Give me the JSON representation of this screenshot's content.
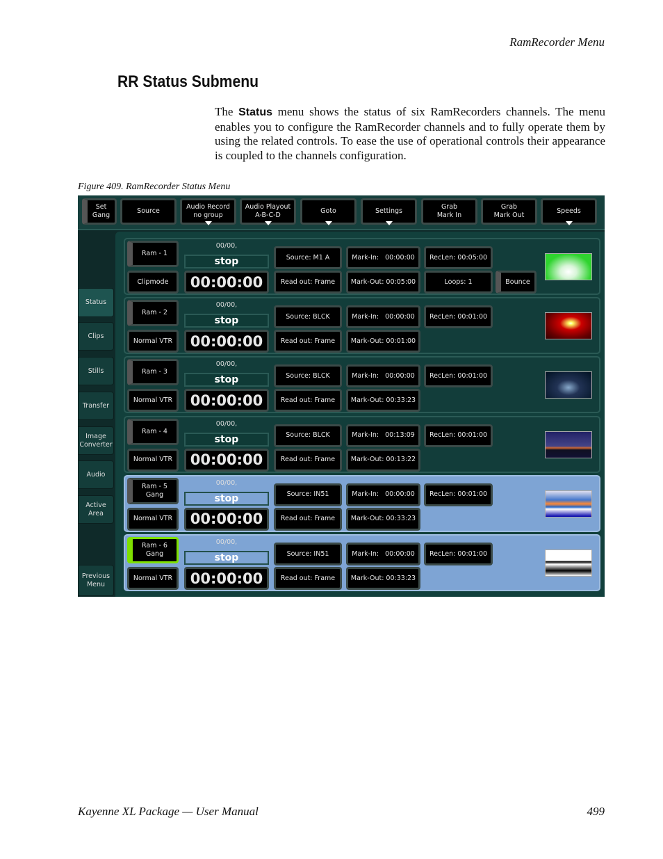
{
  "page": {
    "running_header": "RamRecorder Menu",
    "section_title": "RR Status Submenu",
    "intro_pre": "The ",
    "intro_bold": "Status",
    "intro_post": " menu shows the status of six RamRecorders channels. The menu enables you to configure the RamRecorder channels and to fully operate them by using the related controls. To ease the use of operational controls their appearance is coupled to the channels configuration.",
    "figure_caption": "Figure 409.  RamRecorder Status Menu",
    "footer_left": "Kayenne XL Package  —  User Manual",
    "page_number": "499"
  },
  "toolbar": [
    {
      "label": "Set\nGang"
    },
    {
      "label": "Source"
    },
    {
      "label": "Audio Record\nno group",
      "dropdown": true
    },
    {
      "label": "Audio Playout\nA-B-C-D",
      "dropdown": true
    },
    {
      "label": "Goto",
      "dropdown": true
    },
    {
      "label": "Settings",
      "dropdown": true
    },
    {
      "label": "Grab\nMark In"
    },
    {
      "label": "Grab\nMark Out"
    },
    {
      "label": "Speeds",
      "dropdown": true
    }
  ],
  "sidebar": [
    {
      "label": "Status",
      "selected": true
    },
    {
      "label": "Clips"
    },
    {
      "label": "Stills"
    },
    {
      "label": "Transfer"
    },
    {
      "label": "Image\nConverter"
    },
    {
      "label": "Audio"
    },
    {
      "label": "Active\nArea"
    },
    {
      "label": "Previous\nMenu"
    }
  ],
  "channels": [
    {
      "name": "Ram - 1",
      "mode": "Clipmode",
      "status": "00/00,",
      "state": "stop",
      "timecode": "00:00:00",
      "source": "Source: M1 A",
      "readout": "Read out: Frame",
      "mark_in": "Mark-In:   00:00:00",
      "mark_out": "Mark-Out: 00:05:00",
      "reclen": "RecLen: 00:05:00",
      "loops": "Loops: 1",
      "bounce": "Bounce",
      "thumbnail": "gv-logo-green",
      "highlight": false,
      "indicator": "#555555"
    },
    {
      "name": "Ram - 2",
      "mode": "Normal VTR",
      "status": "00/00,",
      "state": "stop",
      "timecode": "00:00:00",
      "source": "Source: BLCK",
      "readout": "Read out: Frame",
      "mark_in": "Mark-In:   00:00:00",
      "mark_out": "Mark-Out: 00:01:00",
      "reclen": "RecLen: 00:01:00",
      "thumbnail": "red-swirl",
      "highlight": false,
      "indicator": "#555555"
    },
    {
      "name": "Ram - 3",
      "mode": "Normal VTR",
      "status": "00/00,",
      "state": "stop",
      "timecode": "00:00:00",
      "source": "Source: BLCK",
      "readout": "Read out: Frame",
      "mark_in": "Mark-In:   00:00:00",
      "mark_out": "Mark-Out: 00:33:23",
      "reclen": "RecLen: 00:01:00",
      "thumbnail": "blue-space",
      "highlight": false,
      "indicator": "#555555"
    },
    {
      "name": "Ram - 4",
      "mode": "Normal VTR",
      "status": "00/00,",
      "state": "stop",
      "timecode": "00:00:00",
      "source": "Source: BLCK",
      "readout": "Read out: Frame",
      "mark_in": "Mark-In:   00:13:09",
      "mark_out": "Mark-Out: 00:13:22",
      "reclen": "RecLen: 00:01:00",
      "thumbnail": "night-bridge",
      "highlight": false,
      "indicator": "#555555"
    },
    {
      "name": "Ram - 5\nGang",
      "mode": "Normal VTR",
      "status": "00/00,",
      "state": "stop",
      "timecode": "00:00:00",
      "source": "Source: IN51",
      "readout": "Read out: Frame",
      "mark_in": "Mark-In:   00:00:00",
      "mark_out": "Mark-Out: 00:33:23",
      "reclen": "RecLen: 00:01:00",
      "thumbnail": "fifa-color",
      "highlight": true,
      "indicator": "#555555"
    },
    {
      "name": "Ram - 6\nGang",
      "mode": "Normal VTR",
      "status": "00/00,",
      "state": "stop",
      "timecode": "00:00:00",
      "source": "Source: IN51",
      "readout": "Read out: Frame",
      "mark_in": "Mark-In:   00:00:00",
      "mark_out": "Mark-Out: 00:33:23",
      "reclen": "RecLen: 00:01:00",
      "thumbnail": "fifa-bw",
      "highlight": true,
      "indicator": "#7fe000"
    }
  ],
  "colors": {
    "panel": "#12403c",
    "highlight_row": "#7ea4d4",
    "selected_indicator": "#7fe000"
  }
}
